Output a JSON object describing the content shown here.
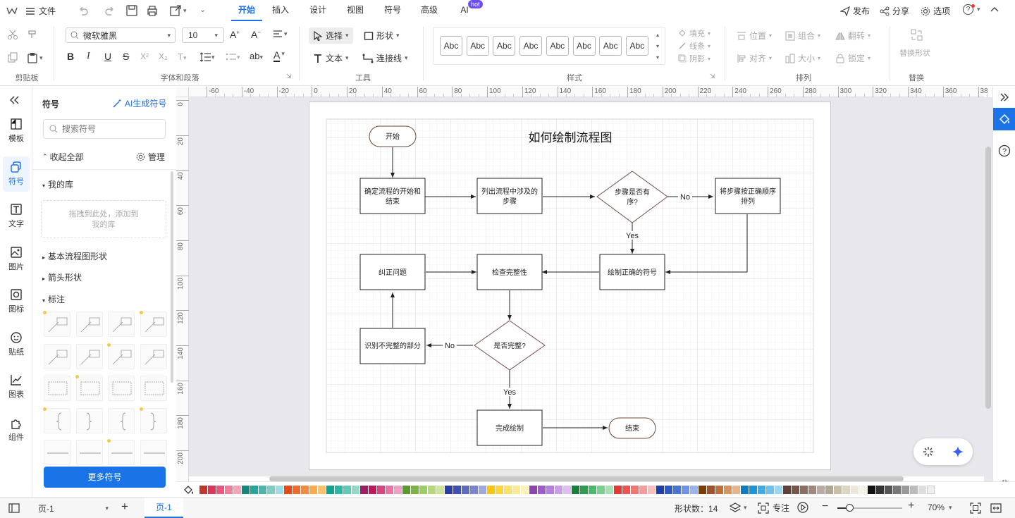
{
  "titlebar": {
    "file_label": "文件",
    "tabs": [
      {
        "label": "开始",
        "active": true
      },
      {
        "label": "插入"
      },
      {
        "label": "设计"
      },
      {
        "label": "视图"
      },
      {
        "label": "符号"
      },
      {
        "label": "高级"
      },
      {
        "label": "AI"
      }
    ],
    "ai_badge": "hot",
    "publish": "发布",
    "share": "分享",
    "options": "选项",
    "help": "?"
  },
  "ribbon": {
    "groups": {
      "clipboard": "剪贴板",
      "font_para": "字体和段落",
      "tools": "工具",
      "styles": "样式",
      "arrange": "排列",
      "replace": "替换"
    },
    "font_name": "微软雅黑",
    "font_size": "10",
    "bold": "B",
    "italic": "I",
    "underline": "U",
    "strike": "S",
    "superscript": "X²",
    "subscript": "X₂",
    "case": "ab",
    "fontcolor": "A",
    "tools": {
      "select": "选择",
      "shape": "形状",
      "text": "文本",
      "connector": "连接线"
    },
    "style_sample": "Abc",
    "style_count": 8,
    "fill": "填充",
    "line": "线条",
    "shadow": "阴影",
    "position": "位置",
    "group": "组合",
    "flip": "翻转",
    "align": "对齐",
    "size": "大小",
    "lock": "锁定",
    "replace_shape": "替换形状"
  },
  "leftnav": [
    {
      "label": "模板",
      "icon": "template-icon"
    },
    {
      "label": "符号",
      "icon": "symbol-icon",
      "active": true
    },
    {
      "label": "文字",
      "icon": "text-icon"
    },
    {
      "label": "图片",
      "icon": "image-icon"
    },
    {
      "label": "图标",
      "icon": "icon-library-icon"
    },
    {
      "label": "贴纸",
      "icon": "sticker-icon"
    },
    {
      "label": "图表",
      "icon": "chart-icon"
    },
    {
      "label": "组件",
      "icon": "component-icon"
    }
  ],
  "symbols": {
    "title": "符号",
    "ai_generate": "AI生成符号",
    "search_placeholder": "搜索符号",
    "collapse_all": "收起全部",
    "manage": "管理",
    "my_library": "我的库",
    "drop_hint_1": "拖拽到此处，添加到",
    "drop_hint_2": "我的库",
    "basic_flow": "基本流程图形状",
    "arrow_shapes": "箭头形状",
    "annotation": "标注",
    "more": "更多符号"
  },
  "ruler": {
    "h_ticks": [
      "-60",
      "-40",
      "-20",
      "0",
      "20",
      "40",
      "60",
      "80",
      "100",
      "120",
      "140",
      "160",
      "180",
      "200",
      "220",
      "240",
      "260",
      "280",
      "300",
      "320",
      "340",
      "360",
      "38"
    ],
    "v_ticks": [
      "0",
      "20",
      "40",
      "60",
      "80",
      "100",
      "120",
      "140",
      "160",
      "180",
      "200"
    ]
  },
  "flowchart": {
    "title": "如何绘制流程图",
    "start": "开始",
    "n1": "确定流程的开始和结束",
    "n1_l1": "确定流程的开始和",
    "n1_l2": "结束",
    "n2_l1": "列出流程中涉及的",
    "n2_l2": "步骤",
    "d1_l1": "步骤是否有",
    "d1_l2": "序?",
    "n3_l1": "将步骤按正确顺序",
    "n3_l2": "排列",
    "n4": "绘制正确的符号",
    "n5": "检查完整性",
    "n6": "纠正问题",
    "d2": "是否完整?",
    "n7": "识别不完整的部分",
    "n8": "完成绘制",
    "end": "结束",
    "no": "No",
    "yes": "Yes"
  },
  "palette_colors": [
    "#c0392b",
    "#e0335a",
    "#e8577e",
    "#f07f9c",
    "#f4a6b6",
    "#13877a",
    "#26a69a",
    "#4db6ac",
    "#80cbc4",
    "#9bdde8",
    "#e64a19",
    "#f26b2e",
    "#f7893c",
    "#fbab4c",
    "#fcc265",
    "#10a38d",
    "#2bb6a3",
    "#60c9b5",
    "#8fdac9",
    "#9c2065",
    "#c2185b",
    "#d9467f",
    "#e874a4",
    "#f0a0c0",
    "#5a9b2b",
    "#7cb342",
    "#9ccc65",
    "#b5d67a",
    "#cfe39b",
    "#2d3da8",
    "#3f51b5",
    "#5c6bc0",
    "#7986cb",
    "#9fa8da",
    "#f9c60b",
    "#fbd53a",
    "#fde16a",
    "#feea91",
    "#fff2b5",
    "#8e44ad",
    "#a05ad0",
    "#b47fe0",
    "#c99de8",
    "#dcc0f0",
    "#17803c",
    "#2e9d52",
    "#4cb86a",
    "#7bcf8f",
    "#a6e0b3",
    "#e53935",
    "#ef5350",
    "#f27572",
    "#f59c9a",
    "#f8bdbd",
    "#1e3fa8",
    "#2e58c8",
    "#4a73d8",
    "#6e92e4",
    "#9ab4ee",
    "#7a3c00",
    "#a0522d",
    "#c0703c",
    "#d8925e",
    "#e8b48a",
    "#0e7ac0",
    "#1a95d8",
    "#40abe2",
    "#6ec2ec",
    "#9bd7f4",
    "#5d4037",
    "#795548",
    "#8d6e63",
    "#a1887f",
    "#bcaaa4",
    "#b0a890",
    "#c8bfa5",
    "#dcd5c0",
    "#ece7d8",
    "#f5f2ea",
    "#111111",
    "#333333",
    "#555555",
    "#777777",
    "#999999",
    "#bbbbbb",
    "#dddddd",
    "#f0f0f0"
  ],
  "status": {
    "page_tab": "页-1",
    "page_active": "页-1",
    "shape_count": "形状数：14",
    "focus": "专注",
    "zoom": "70%"
  }
}
